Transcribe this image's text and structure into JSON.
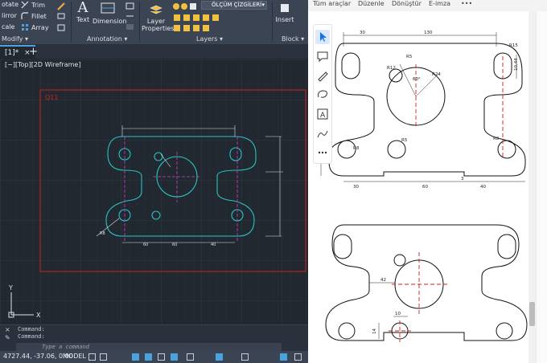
{
  "ribbon": {
    "modify": {
      "rotate": "otate",
      "trim": "Trim",
      "mirror": "lirror",
      "fillet": "Fillet",
      "scale": "cale",
      "array": "Array",
      "title": "Modify"
    },
    "annotation": {
      "text": "Text",
      "dimension": "Dimension",
      "title": "Annotation"
    },
    "layers": {
      "layer_props": "Layer\nProperties",
      "layer_name": "ÖLÇÜM ÇİZGİLERİ",
      "title": "Layers"
    },
    "block": {
      "insert": "Insert",
      "title": "Block"
    }
  },
  "tabs": {
    "doc_tab": "[1]*",
    "plus": "+"
  },
  "viewport": {
    "label": "[−][Top][2D Wireframe]",
    "red_label": "Q11",
    "dims": [
      "60",
      "60",
      "40",
      "R8"
    ],
    "ucs_y": "Y",
    "ucs_x": "X"
  },
  "command": {
    "line1": "Command:",
    "line2": "Command:",
    "placeholder": "Type a command"
  },
  "status": {
    "coords": "4727.44, -37.06, 0.00",
    "model": "MODEL"
  },
  "pdf": {
    "menu": [
      "Tüm araçlar",
      "Düzenle",
      "Dönüştür",
      "E-imza",
      "•••"
    ],
    "drawing_top": {
      "dims": [
        "30",
        "130",
        "R15",
        "10,44",
        "R12",
        "R24",
        "R5",
        "R8",
        "R5",
        "R8",
        "30",
        "60",
        "40",
        "3",
        "60°"
      ]
    },
    "drawing_bottom": {
      "dims": [
        "42",
        "10",
        "14"
      ]
    }
  },
  "colors": {
    "autocad_bg": "#212830",
    "ribbon_bg": "#3b4453",
    "cyan": "#2ac3c3",
    "red": "#e03030",
    "magenta": "#d040d0",
    "accent": "#4aa3df",
    "pdf_accent": "#1473e6"
  }
}
